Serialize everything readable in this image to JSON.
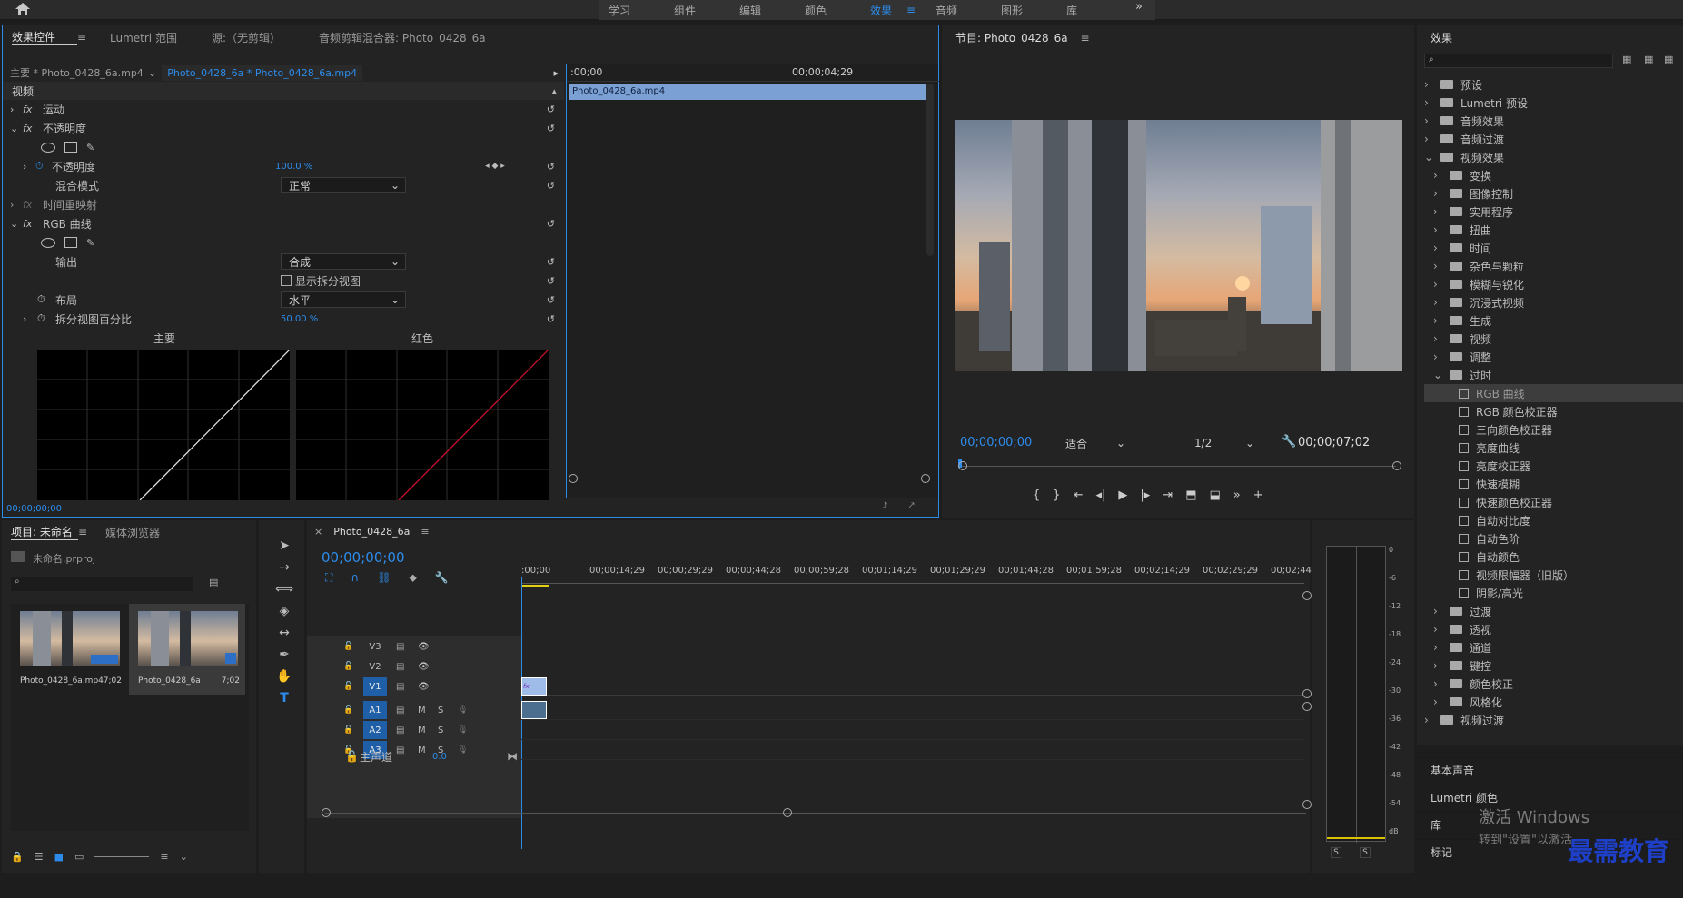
{
  "top_nav": {
    "items": [
      "学习",
      "组件",
      "编辑",
      "颜色",
      "效果",
      "音频",
      "图形",
      "库"
    ],
    "active": "效果",
    "more": "»"
  },
  "ec": {
    "tabs": [
      "效果控件",
      "Lumetri 范围",
      "源:（无剪辑）",
      "音频剪辑混合器: Photo_0428_6a"
    ],
    "master_label": "主要 * Photo_0428_6a.mp4",
    "seq_label": "Photo_0428_6a * Photo_0428_6a.mp4",
    "time_start": ":00;00",
    "time_end": "00;00;04;29",
    "clip_name": "Photo_0428_6a.mp4",
    "video_header": "视频",
    "motion": "运动",
    "opacity": "不透明度",
    "opacity_param": "不透明度",
    "opacity_value": "100.0 %",
    "blend_label": "混合模式",
    "blend_value": "正常",
    "timeremap": "时间重映射",
    "rgb_curves": "RGB 曲线",
    "output_label": "输出",
    "output_value": "合成",
    "show_split": "显示拆分视图",
    "layout_label": "布局",
    "layout_value": "水平",
    "split_pct_label": "拆分视图百分比",
    "split_pct_value": "50.00 %",
    "curve_main": "主要",
    "curve_red": "红色",
    "footer_time": "00;00;00;00",
    "fx": "fx"
  },
  "program": {
    "title": "节目: Photo_0428_6a",
    "timecode": "00;00;00;00",
    "fit": "适合",
    "quality": "1/2",
    "duration": "00;00;07;02"
  },
  "effects": {
    "title": "效果",
    "items": [
      {
        "label": "预设",
        "type": "folder",
        "level": 0,
        "open": false
      },
      {
        "label": "Lumetri 预设",
        "type": "folder",
        "level": 0,
        "open": false
      },
      {
        "label": "音频效果",
        "type": "folder",
        "level": 0,
        "open": false
      },
      {
        "label": "音频过渡",
        "type": "folder",
        "level": 0,
        "open": false
      },
      {
        "label": "视频效果",
        "type": "folder",
        "level": 0,
        "open": true
      },
      {
        "label": "变换",
        "type": "folder",
        "level": 1,
        "open": false
      },
      {
        "label": "图像控制",
        "type": "folder",
        "level": 1,
        "open": false
      },
      {
        "label": "实用程序",
        "type": "folder",
        "level": 1,
        "open": false
      },
      {
        "label": "扭曲",
        "type": "folder",
        "level": 1,
        "open": false
      },
      {
        "label": "时间",
        "type": "folder",
        "level": 1,
        "open": false
      },
      {
        "label": "杂色与颗粒",
        "type": "folder",
        "level": 1,
        "open": false
      },
      {
        "label": "模糊与锐化",
        "type": "folder",
        "level": 1,
        "open": false
      },
      {
        "label": "沉浸式视频",
        "type": "folder",
        "level": 1,
        "open": false
      },
      {
        "label": "生成",
        "type": "folder",
        "level": 1,
        "open": false
      },
      {
        "label": "视频",
        "type": "folder",
        "level": 1,
        "open": false
      },
      {
        "label": "调整",
        "type": "folder",
        "level": 1,
        "open": false
      },
      {
        "label": "过时",
        "type": "folder",
        "level": 1,
        "open": true
      },
      {
        "label": "RGB 曲线",
        "type": "preset",
        "level": 2,
        "selected": true
      },
      {
        "label": "RGB 颜色校正器",
        "type": "preset",
        "level": 2
      },
      {
        "label": "三向颜色校正器",
        "type": "preset",
        "level": 2
      },
      {
        "label": "亮度曲线",
        "type": "preset",
        "level": 2
      },
      {
        "label": "亮度校正器",
        "type": "preset",
        "level": 2
      },
      {
        "label": "快速模糊",
        "type": "preset",
        "level": 2
      },
      {
        "label": "快速颜色校正器",
        "type": "preset",
        "level": 2
      },
      {
        "label": "自动对比度",
        "type": "preset",
        "level": 2
      },
      {
        "label": "自动色阶",
        "type": "preset",
        "level": 2
      },
      {
        "label": "自动颜色",
        "type": "preset",
        "level": 2
      },
      {
        "label": "视频限幅器（旧版）",
        "type": "preset",
        "level": 2
      },
      {
        "label": "阴影/高光",
        "type": "preset",
        "level": 2
      },
      {
        "label": "过渡",
        "type": "folder",
        "level": 1,
        "open": false
      },
      {
        "label": "透视",
        "type": "folder",
        "level": 1,
        "open": false
      },
      {
        "label": "通道",
        "type": "folder",
        "level": 1,
        "open": false
      },
      {
        "label": "键控",
        "type": "folder",
        "level": 1,
        "open": false
      },
      {
        "label": "颜色校正",
        "type": "folder",
        "level": 1,
        "open": false
      },
      {
        "label": "风格化",
        "type": "folder",
        "level": 1,
        "open": false
      },
      {
        "label": "视频过渡",
        "type": "folder",
        "level": 0,
        "open": false
      }
    ],
    "bottom_panels": [
      "基本声音",
      "Lumetri 颜色",
      "库",
      "标记"
    ]
  },
  "project": {
    "tabs": [
      "项目: 未命名",
      "媒体浏览器"
    ],
    "file": "未命名.prproj",
    "items": [
      {
        "name": "Photo_0428_6a.mp4",
        "dur": "7;02"
      },
      {
        "name": "Photo_0428_6a",
        "dur": "7;02"
      }
    ]
  },
  "timeline": {
    "tab": "Photo_0428_6a",
    "timecode": "00;00;00;00",
    "ruler": [
      ":00;00",
      "00;00;14;29",
      "00;00;29;29",
      "00;00;44;28",
      "00;00;59;28",
      "00;01;14;29",
      "00;01;29;29",
      "00;01;44;28",
      "00;01;59;28",
      "00;02;14;29",
      "00;02;29;29",
      "00;02;44;"
    ],
    "video_tracks": [
      "V3",
      "V2",
      "V1"
    ],
    "audio_tracks": [
      "A1",
      "A2",
      "A3"
    ],
    "master": "主声道",
    "master_val": "0.0",
    "m": "M",
    "s": "S",
    "fx": "fx"
  },
  "meter": {
    "scale": [
      "0",
      "-6",
      "-12",
      "-18",
      "-24",
      "-30",
      "-36",
      "-42",
      "-48",
      "-54",
      "dB"
    ],
    "s": "S"
  },
  "watermark": {
    "line1": "激活 Windows",
    "line2": "转到\"设置\"以激活",
    "brand": "最需教育"
  }
}
